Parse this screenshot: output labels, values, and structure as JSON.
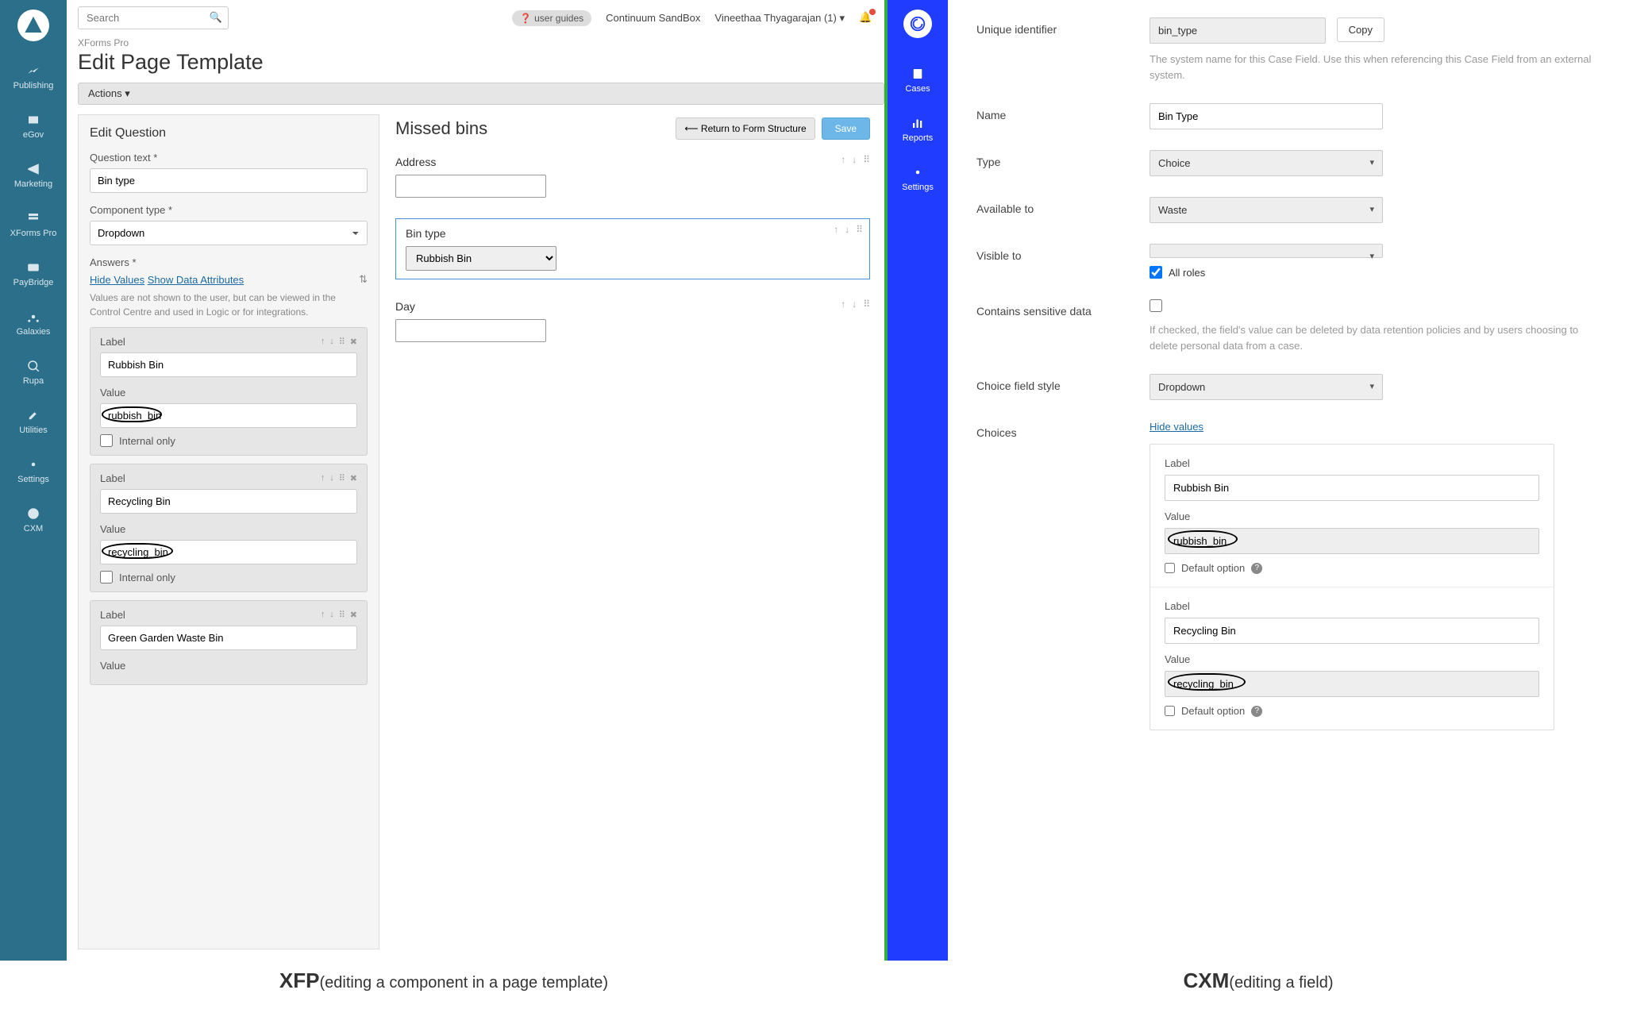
{
  "left": {
    "sidebar": [
      {
        "label": "Publishing"
      },
      {
        "label": "eGov"
      },
      {
        "label": "Marketing"
      },
      {
        "label": "XForms Pro"
      },
      {
        "label": "PayBridge"
      },
      {
        "label": "Galaxies"
      },
      {
        "label": "Rupa"
      },
      {
        "label": "Utilities"
      },
      {
        "label": "Settings"
      },
      {
        "label": "CXM"
      }
    ],
    "search_placeholder": "Search",
    "user_guides": "user guides",
    "sandbox": "Continuum SandBox",
    "user": "Vineethaa Thyagarajan (1)",
    "breadcrumb": "XForms Pro",
    "page_title": "Edit Page Template",
    "actions": "Actions",
    "edit_title": "Edit Question",
    "qtext_label": "Question text",
    "qtext_value": "Bin type",
    "ctype_label": "Component type",
    "ctype_value": "Dropdown",
    "answers_label": "Answers",
    "hide_values": "Hide Values",
    "show_attrs": "Show Data Attributes",
    "values_help": "Values are not shown to the user, but can be viewed in the Control Centre and used in Logic or for integrations.",
    "answers": [
      {
        "label_head": "Label",
        "label": "Rubbish Bin",
        "value_head": "Value",
        "value": "rubbish_bin",
        "internal_only": "Internal only",
        "circled": true
      },
      {
        "label_head": "Label",
        "label": "Recycling Bin",
        "value_head": "Value",
        "value": "recycling_bin",
        "internal_only": "Internal only",
        "circled": true
      },
      {
        "label_head": "Label",
        "label": "Green Garden Waste Bin",
        "value_head": "Value",
        "value": "",
        "internal_only": "",
        "circled": false
      }
    ],
    "preview": {
      "title": "Missed bins",
      "return": "Return to Form Structure",
      "save": "Save",
      "fields": [
        {
          "label": "Address",
          "type": "text"
        },
        {
          "label": "Bin type",
          "type": "select",
          "value": "Rubbish Bin",
          "active": true
        },
        {
          "label": "Day",
          "type": "text"
        }
      ]
    }
  },
  "right": {
    "sidebar": [
      {
        "label": "Cases"
      },
      {
        "label": "Reports"
      },
      {
        "label": "Settings"
      }
    ],
    "fields": {
      "uid_label": "Unique identifier",
      "uid_value": "bin_type",
      "copy": "Copy",
      "uid_help": "The system name for this Case Field. Use this when referencing this Case Field from an external system.",
      "name_label": "Name",
      "name_value": "Bin Type",
      "type_label": "Type",
      "type_value": "Choice",
      "avail_label": "Available to",
      "avail_value": "Waste",
      "visible_label": "Visible to",
      "visible_value": "",
      "all_roles": "All roles",
      "sensitive_label": "Contains sensitive data",
      "sensitive_help": "If checked, the field's value can be deleted by data retention policies and by users choosing to delete personal data from a case.",
      "style_label": "Choice field style",
      "style_value": "Dropdown",
      "choices_label": "Choices",
      "hide_values": "Hide values"
    },
    "choices": [
      {
        "label_h": "Label",
        "label": "Rubbish Bin",
        "value_h": "Value",
        "value": "rubbish_bin",
        "default": "Default option",
        "circled": true
      },
      {
        "label_h": "Label",
        "label": "Recycling Bin",
        "value_h": "Value",
        "value": "recycling_bin",
        "default": "Default option",
        "circled": true
      }
    ]
  },
  "captions": {
    "left_bold": "XFP",
    "left_plain": "(editing a component in a page template)",
    "right_bold": "CXM",
    "right_plain": "(editing a field)"
  }
}
